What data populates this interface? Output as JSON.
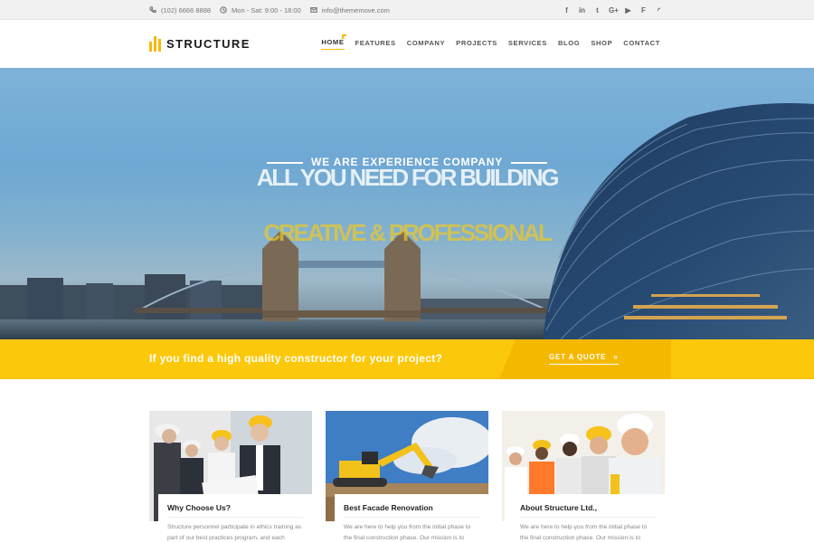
{
  "topbar": {
    "phone": "(102) 6666 8888",
    "hours": "Mon - Sat: 9:00 - 18:00",
    "email": "info@thememove.com",
    "social_icons": [
      "facebook-icon",
      "linkedin-icon",
      "twitter-icon",
      "google-plus-icon",
      "youtube-icon",
      "foursquare-icon",
      "rss-icon"
    ],
    "social_glyphs": [
      "f",
      "in",
      "t",
      "G+",
      "▶",
      "F",
      "◜"
    ]
  },
  "header": {
    "logo_text": "STRUCTURE",
    "nav": [
      "HOME",
      "FEATURES",
      "COMPANY",
      "PROJECTS",
      "SERVICES",
      "BLOG",
      "SHOP",
      "CONTACT"
    ],
    "active_nav": "HOME"
  },
  "hero": {
    "subtitle": "WE ARE EXPERIENCE COMPANY",
    "title": "ALL YOU NEED FOR BUILDING",
    "tagline": "CREATIVE & PROFESSIONAL"
  },
  "cta": {
    "text": "If you find a high quality constructor for your project?",
    "button": "GET A QUOTE",
    "button_icon": "»"
  },
  "cards": [
    {
      "title": "Why Choose Us?",
      "text": "Structure personnel participate in ethics training as part of our best practices program, and each"
    },
    {
      "title": "Best Facade Renovation",
      "text": "We are here to help you from the initial phase to the final construction phase. Our mission is to"
    },
    {
      "title": "About Structure Ltd.,",
      "text": "We are here to help you from the initial phase to the final construction phase. Our mission is to"
    }
  ],
  "colors": {
    "accent": "#fcc80b",
    "accent_dark": "#f5b800",
    "topbar_bg": "#f1f1f1"
  }
}
